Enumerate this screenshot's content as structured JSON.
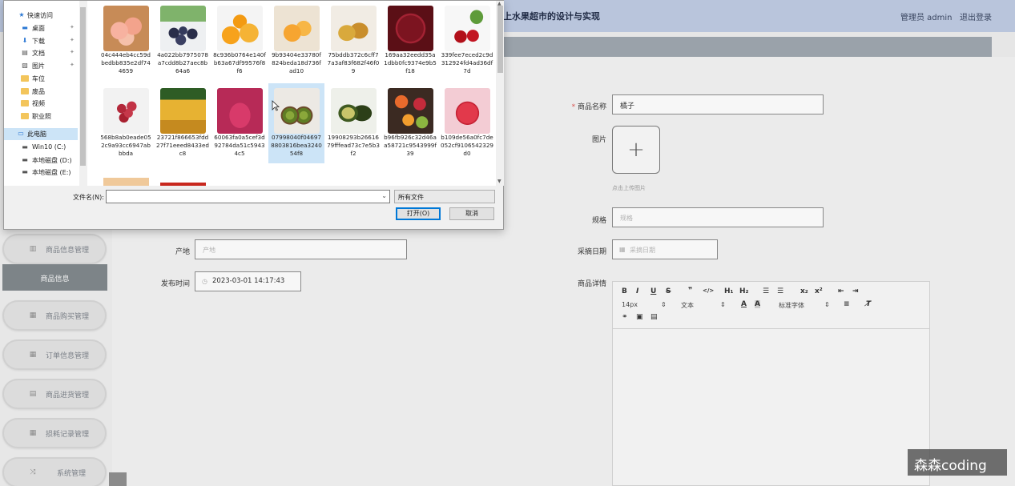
{
  "app": {
    "title": "上水果超市的设计与实现",
    "admin_name": "管理员 admin",
    "logout": "退出登录"
  },
  "sidebar": {
    "items": [
      {
        "label": "商品信息管理",
        "icon": "bar-chart-icon"
      },
      {
        "label": "商品信息",
        "active": true
      },
      {
        "label": "商品购买管理",
        "icon": "grid-icon"
      },
      {
        "label": "订单信息管理",
        "icon": "grid-icon"
      },
      {
        "label": "商品进货管理",
        "icon": "document-icon"
      },
      {
        "label": "损耗记录管理",
        "icon": "grid-icon"
      },
      {
        "label": "系统管理",
        "icon": "shuffle-icon"
      }
    ]
  },
  "form": {
    "name_label": "商品名称",
    "name_value": "橘子",
    "image_label": "图片",
    "upload_tip": "点击上传图片",
    "spec_label": "规格",
    "spec_placeholder": "规格",
    "origin_label": "产地",
    "origin_placeholder": "产地",
    "pick_date_label": "采摘日期",
    "pick_date_placeholder": "采摘日期",
    "publish_time_label": "发布时间",
    "publish_time_value": "2023-03-01 14:17:43",
    "detail_label": "商品详情"
  },
  "editor": {
    "font_size": "14px",
    "text_style": "文本",
    "font_family": "标准字体"
  },
  "dialog": {
    "nav": [
      {
        "label": "快速访问",
        "icon": "star-icon"
      },
      {
        "label": "桌面",
        "icon": "desktop-icon",
        "pinned": true
      },
      {
        "label": "下载",
        "icon": "download-icon",
        "pinned": true
      },
      {
        "label": "文档",
        "icon": "document-icon",
        "pinned": true
      },
      {
        "label": "图片",
        "icon": "picture-icon",
        "pinned": true
      },
      {
        "label": "车位",
        "icon": "folder-icon"
      },
      {
        "label": "废品",
        "icon": "folder-icon"
      },
      {
        "label": "视频",
        "icon": "folder-icon"
      },
      {
        "label": "职业照",
        "icon": "folder-icon"
      },
      {
        "label": "此电脑",
        "icon": "computer-icon",
        "selected": true
      },
      {
        "label": "Win10 (C:)",
        "icon": "drive-icon"
      },
      {
        "label": "本地磁盘 (D:)",
        "icon": "drive-icon"
      },
      {
        "label": "本地磁盘 (E:)",
        "icon": "drive-icon"
      }
    ],
    "files": [
      {
        "name": "04c444eb4cc59dbedbb835e2df744659",
        "fruit": "peach"
      },
      {
        "name": "4a022bb7975078a7cdd8b27aec8b64a6",
        "fruit": "blueberry"
      },
      {
        "name": "8c936b0764e140fb63a67df99576f8f6",
        "fruit": "orange"
      },
      {
        "name": "9b93404e33780f824beda18d736fad10",
        "fruit": "tangerine"
      },
      {
        "name": "75bddb372c6cff77a3af83f682f46f09",
        "fruit": "pear"
      },
      {
        "name": "169aa32eedd35a1dbb0fc9374e9b5f18",
        "fruit": "cherry-bowl"
      },
      {
        "name": "339fee7eced2c9d312924fd4ad36df7d",
        "fruit": "cherry"
      },
      {
        "name": "568b8ab0eade052c9a93cc6947abbbda",
        "fruit": "grape"
      },
      {
        "name": "23721f866653fdd27f71eeed8433edc8",
        "fruit": "pineapple"
      },
      {
        "name": "60063fa0a5cef3d92784da51c59434c5",
        "fruit": "dragonfruit"
      },
      {
        "name": "07998040f046978803816bea324054f8",
        "fruit": "kiwi",
        "selected": true
      },
      {
        "name": "19908293b2661679fffead73c7e5b3f2",
        "fruit": "avocado"
      },
      {
        "name": "b96fb926c32d46aa58721c9543999f39",
        "fruit": "mixed"
      },
      {
        "name": "b109de56a0fc7de052cf9106542329d0",
        "fruit": "apple"
      }
    ],
    "filename_label": "文件名(N):",
    "filename_value": "",
    "filetype": "所有文件",
    "open_button": "打开(O)",
    "cancel_button": "取消"
  },
  "watermark": "森森coding",
  "colors": {
    "topbar": "#b9c5dc",
    "active_sidebar": "#7d8488",
    "selection": "#cce4f7",
    "required": "#d9534f"
  }
}
